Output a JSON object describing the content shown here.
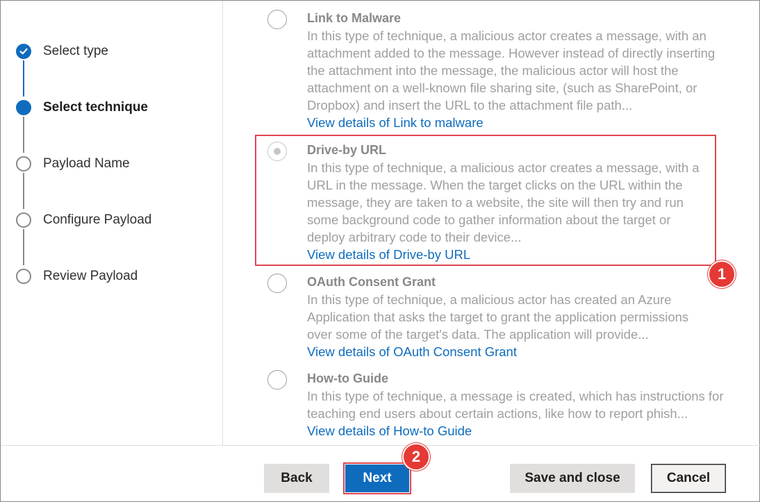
{
  "steps": [
    {
      "label": "Select type",
      "state": "done"
    },
    {
      "label": "Select technique",
      "state": "current"
    },
    {
      "label": "Payload Name",
      "state": "pending"
    },
    {
      "label": "Configure Payload",
      "state": "pending"
    },
    {
      "label": "Review Payload",
      "state": "pending"
    }
  ],
  "options": [
    {
      "title": "Link to Malware",
      "description": "In this type of technique, a malicious actor creates a message, with an attachment added to the message. However instead of directly inserting the attachment into the message, the malicious actor will host the attachment on a well-known file sharing site, (such as SharePoint, or Dropbox) and insert the URL to the attachment file path...",
      "link": "View details of Link to malware",
      "selected": false
    },
    {
      "title": "Drive-by URL",
      "description": "In this type of technique, a malicious actor creates a message, with a URL in the message. When the target clicks on the URL within the message, they are taken to a website, the site will then try and run some background code to gather information about the target or deploy arbitrary code to their device...",
      "link": "View details of Drive-by URL",
      "selected": true
    },
    {
      "title": "OAuth Consent Grant",
      "description": "In this type of technique, a malicious actor has created an Azure Application that asks the target to grant the application permissions over some of the target's data. The application will provide...",
      "link": "View details of OAuth Consent Grant",
      "selected": false
    },
    {
      "title": "How-to Guide",
      "description": "In this type of technique, a message is created, which has instructions for teaching end users about certain actions, like how to report phish...",
      "link": "View details of How-to Guide",
      "selected": false
    }
  ],
  "annotations": {
    "badge1": "1",
    "badge2": "2"
  },
  "footer": {
    "back_label": "Back",
    "next_label": "Next",
    "save_close_label": "Save and close",
    "cancel_label": "Cancel"
  },
  "colors": {
    "accent": "#0f6cbd",
    "highlight": "#e0454d",
    "badge": "#e53935"
  }
}
